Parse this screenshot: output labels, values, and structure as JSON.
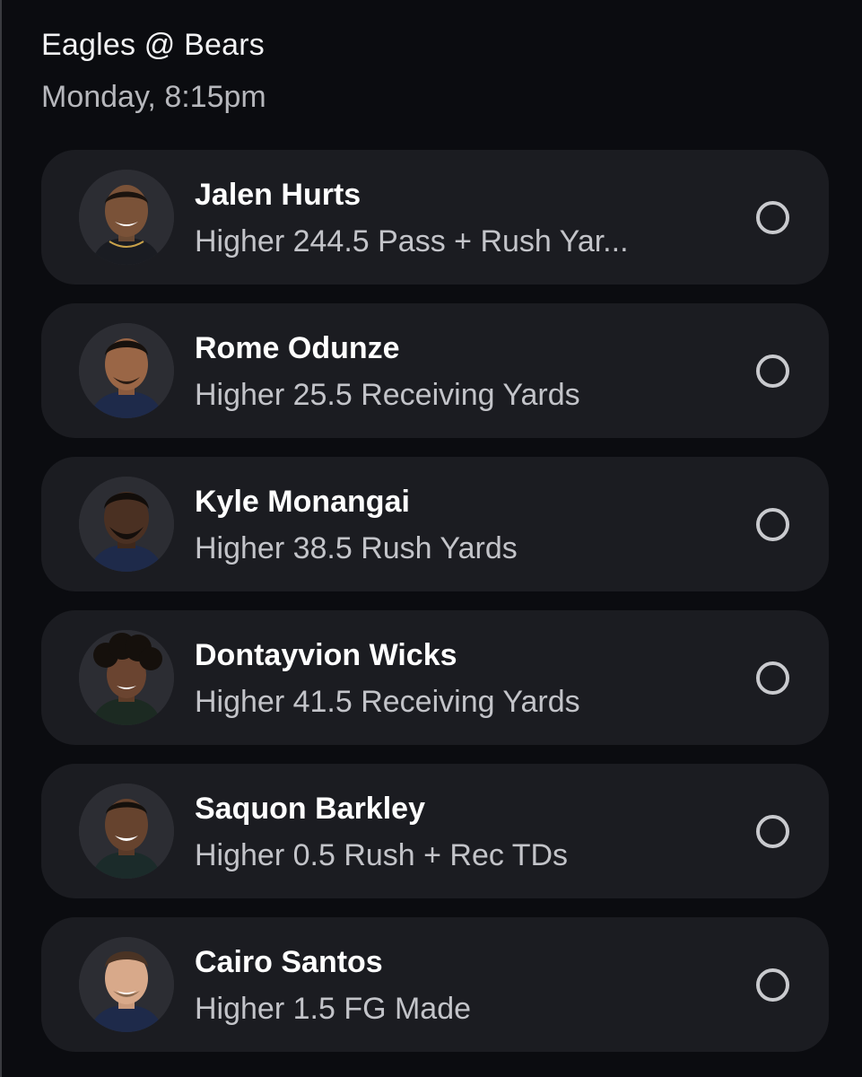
{
  "game": {
    "matchup": "Eagles @ Bears",
    "time": "Monday, 8:15pm"
  },
  "colors": {
    "background": "#0b0c10",
    "card": "#1b1c21",
    "name_text": "#ffffff",
    "secondary_text": "#c3c4c9",
    "radio": "#c9cace"
  },
  "picks": [
    {
      "player": "Jalen Hurts",
      "line": "Higher 244.5 Pass + Rush Yar...",
      "selected": false,
      "icon": "player-headshot"
    },
    {
      "player": "Rome Odunze",
      "line": "Higher 25.5 Receiving Yards",
      "selected": false,
      "icon": "player-headshot"
    },
    {
      "player": "Kyle Monangai",
      "line": "Higher 38.5 Rush Yards",
      "selected": false,
      "icon": "player-headshot"
    },
    {
      "player": "Dontayvion Wicks",
      "line": "Higher 41.5 Receiving Yards",
      "selected": false,
      "icon": "player-headshot"
    },
    {
      "player": "Saquon Barkley",
      "line": "Higher 0.5 Rush + Rec TDs",
      "selected": false,
      "icon": "player-headshot"
    },
    {
      "player": "Cairo Santos",
      "line": "Higher 1.5 FG Made",
      "selected": false,
      "icon": "player-headshot"
    }
  ]
}
